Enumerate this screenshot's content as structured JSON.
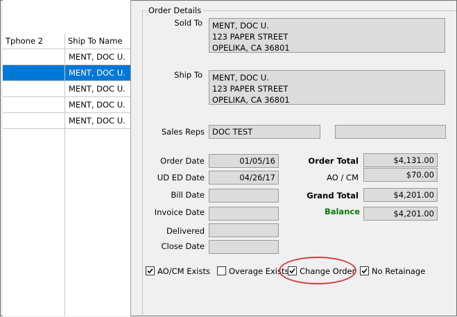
{
  "grid": {
    "columns": [
      "Tphone 2",
      "Ship To Name"
    ],
    "rows": [
      {
        "tphone2": "",
        "ship_to_name": "MENT, DOC U.",
        "selected": false
      },
      {
        "tphone2": "",
        "ship_to_name": "MENT, DOC U.",
        "selected": true
      },
      {
        "tphone2": "",
        "ship_to_name": "MENT, DOC U.",
        "selected": false
      },
      {
        "tphone2": "",
        "ship_to_name": "MENT, DOC U.",
        "selected": false
      },
      {
        "tphone2": "",
        "ship_to_name": "MENT, DOC U.",
        "selected": false
      }
    ]
  },
  "order_details": {
    "title": "Order Details",
    "sold_to": {
      "label": "Sold To",
      "lines": [
        "MENT, DOC U.",
        "123 PAPER STREET",
        "OPELIKA, CA  36801"
      ]
    },
    "ship_to": {
      "label": "Ship To",
      "lines": [
        "MENT, DOC U.",
        "123 PAPER STREET",
        "OPELIKA, CA  36801"
      ]
    },
    "sales_reps": {
      "label": "Sales Reps",
      "value1": "DOC TEST",
      "value2": ""
    },
    "dates": [
      {
        "label": "Order Date",
        "value": "01/05/16"
      },
      {
        "label": "UD ED Date",
        "value": "04/26/17"
      },
      {
        "label": "Bill Date",
        "value": ""
      },
      {
        "label": "Invoice Date",
        "value": ""
      },
      {
        "label": "Delivered",
        "value": ""
      },
      {
        "label": "Close Date",
        "value": ""
      }
    ],
    "totals": {
      "order_total": {
        "label": "Order Total",
        "value": "$4,131.00"
      },
      "ao_cm": {
        "label": "AO / CM",
        "value": "$70.00"
      },
      "grand_total": {
        "label": "Grand Total",
        "value": "$4,201.00"
      },
      "balance": {
        "label": "Balance",
        "value": "$4,201.00"
      }
    },
    "checkboxes": [
      {
        "label": "AO/CM Exists",
        "checked": true
      },
      {
        "label": "Overage Exists",
        "checked": false
      },
      {
        "label": "Change Order",
        "checked": true
      },
      {
        "label": "No Retainage",
        "checked": true
      }
    ]
  },
  "colors": {
    "selection": "#0078d7",
    "balance": "#0a7a0a",
    "highlight_ring": "#d23c3c"
  }
}
